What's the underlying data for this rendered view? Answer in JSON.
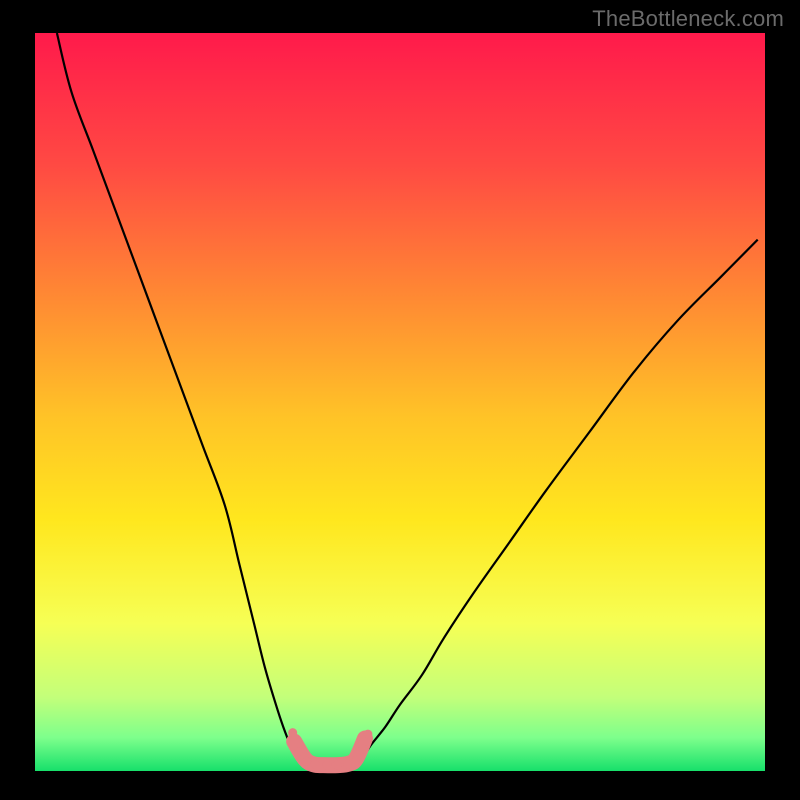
{
  "watermark": {
    "text": "TheBottleneck.com"
  },
  "chart_data": {
    "type": "line",
    "title": "",
    "xlabel": "",
    "ylabel": "",
    "xlim": [
      0,
      100
    ],
    "ylim": [
      0,
      100
    ],
    "grid": false,
    "legend": false,
    "annotations": [],
    "background": "rainbow-gradient",
    "gradient_stops": [
      {
        "offset": 0.0,
        "color": "#ff1a4b"
      },
      {
        "offset": 0.18,
        "color": "#ff4a43"
      },
      {
        "offset": 0.36,
        "color": "#ff8a33"
      },
      {
        "offset": 0.52,
        "color": "#ffc327"
      },
      {
        "offset": 0.66,
        "color": "#ffe71e"
      },
      {
        "offset": 0.8,
        "color": "#f6ff55"
      },
      {
        "offset": 0.9,
        "color": "#c3ff7a"
      },
      {
        "offset": 0.955,
        "color": "#7dff8c"
      },
      {
        "offset": 1.0,
        "color": "#17e06b"
      }
    ],
    "series": [
      {
        "name": "left-curve",
        "color": "#000000",
        "stroke_width": 2.2,
        "x": [
          3,
          5,
          8,
          11,
          14,
          17,
          20,
          23,
          26,
          28,
          30,
          31.5,
          33,
          34,
          35,
          36,
          37
        ],
        "y": [
          100,
          92,
          84,
          76,
          68,
          60,
          52,
          44,
          36,
          28,
          20,
          14,
          9,
          6,
          3.5,
          1.8,
          1.2
        ]
      },
      {
        "name": "right-curve",
        "color": "#000000",
        "stroke_width": 2.2,
        "x": [
          44,
          45,
          46,
          48,
          50,
          53,
          56,
          60,
          65,
          70,
          76,
          82,
          88,
          94,
          99
        ],
        "y": [
          1.2,
          2,
          3.5,
          6,
          9,
          13,
          18,
          24,
          31,
          38,
          46,
          54,
          61,
          67,
          72
        ]
      },
      {
        "name": "valley-marker",
        "color": "#e57f82",
        "stroke_width": 16,
        "linecap": "round",
        "x": [
          35.5,
          37.0,
          38.2,
          39.5,
          41.5,
          43.0,
          44.0,
          45.2
        ],
        "y": [
          4.0,
          1.6,
          0.9,
          0.8,
          0.8,
          1.0,
          1.7,
          4.4
        ]
      },
      {
        "name": "valley-dots",
        "type": "scatter",
        "marker": "circle",
        "marker_size": 9,
        "color": "#e57f82",
        "x": [
          35.3,
          36.1,
          37.2,
          38.4,
          40.0,
          41.4,
          42.8,
          44.0,
          44.9,
          45.6
        ],
        "y": [
          5.2,
          2.6,
          1.3,
          0.9,
          0.8,
          0.8,
          0.9,
          1.5,
          3.0,
          5.0
        ]
      }
    ]
  }
}
